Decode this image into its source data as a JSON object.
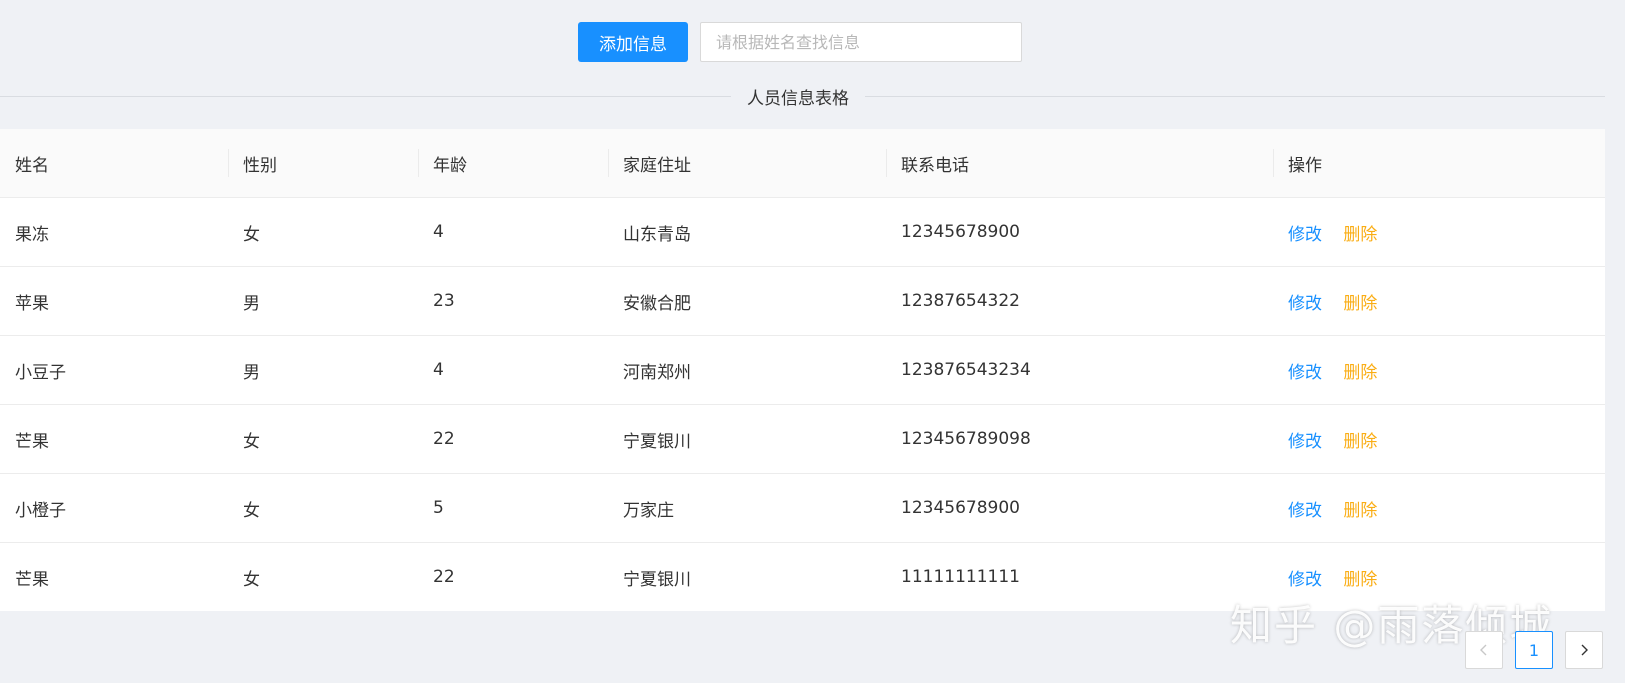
{
  "toolbar": {
    "add_label": "添加信息",
    "search_placeholder": "请根据姓名查找信息",
    "search_value": ""
  },
  "table_title": "人员信息表格",
  "columns": [
    "姓名",
    "性别",
    "年龄",
    "家庭住址",
    "联系电话",
    "操作"
  ],
  "actions": {
    "edit": "修改",
    "delete": "删除"
  },
  "rows": [
    {
      "name": "果冻",
      "gender": "女",
      "age": "4",
      "address": "山东青岛",
      "phone": "12345678900"
    },
    {
      "name": "苹果",
      "gender": "男",
      "age": "23",
      "address": "安徽合肥",
      "phone": "12387654322"
    },
    {
      "name": "小豆子",
      "gender": "男",
      "age": "4",
      "address": "河南郑州",
      "phone": "123876543234"
    },
    {
      "name": "芒果",
      "gender": "女",
      "age": "22",
      "address": "宁夏银川",
      "phone": "123456789098"
    },
    {
      "name": "小橙子",
      "gender": "女",
      "age": "5",
      "address": "万家庄",
      "phone": "12345678900"
    },
    {
      "name": "芒果",
      "gender": "女",
      "age": "22",
      "address": "宁夏银川",
      "phone": "11111111111"
    }
  ],
  "pagination": {
    "current": "1",
    "prev_icon": "chevron-left-icon",
    "next_icon": "chevron-right-icon"
  },
  "watermark": "知乎 @雨落倾城",
  "colors": {
    "primary": "#1890ff",
    "warning": "#faad14",
    "background": "#eff1f5"
  }
}
